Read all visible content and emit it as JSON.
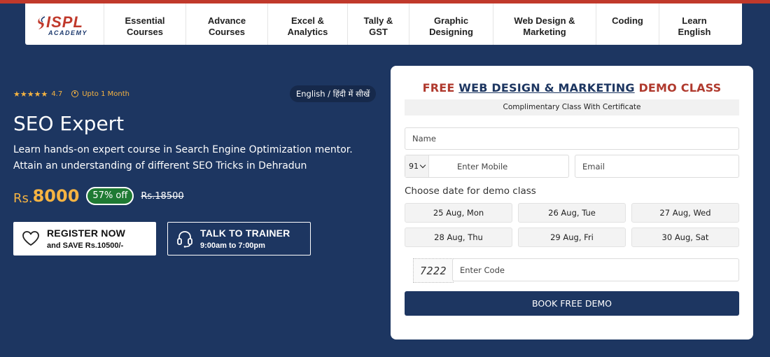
{
  "nav": {
    "logo": {
      "brand": "ISPL",
      "tagline": "ACADEMY"
    },
    "items": [
      {
        "label": "Essential\nCourses"
      },
      {
        "label": "Advance\nCourses"
      },
      {
        "label": "Excel &\nAnalytics"
      },
      {
        "label": "Tally &\nGST"
      },
      {
        "label": "Graphic\nDesigning"
      },
      {
        "label": "Web Design &\nMarketing"
      },
      {
        "label": "Coding"
      },
      {
        "label": "Learn\nEnglish"
      }
    ]
  },
  "hero": {
    "rating": {
      "stars": "★★★★★",
      "value": "4.7"
    },
    "duration": "Upto 1 Month",
    "language": "English / हिंदी में सीखें",
    "title": "SEO Expert",
    "description": "Learn hands-on expert course in Search Engine Optimization mentor. Attain an understanding of different SEO Tricks in Dehradun",
    "price": {
      "prefix": "Rs.",
      "value": "8000",
      "discount": "57% off",
      "original": "Rs.18500"
    },
    "register": {
      "title": "REGISTER NOW",
      "subtitle": "and SAVE Rs.10500/-"
    },
    "trainer": {
      "title": "TALK TO TRAINER",
      "subtitle": "9:00am to 7:00pm"
    }
  },
  "form": {
    "title_prefix": "FREE ",
    "title_highlight": "WEB DESIGN & MARKETING",
    "title_suffix": " DEMO CLASS",
    "certificate": "Complimentary Class With Certificate",
    "name_placeholder": "Name",
    "country_code": "91",
    "mobile_placeholder": "Enter Mobile",
    "email_placeholder": "Email",
    "choose_date_label": "Choose date for demo class",
    "dates": [
      "25 Aug, Mon",
      "26 Aug, Tue",
      "27 Aug, Wed",
      "28 Aug, Thu",
      "29 Aug, Fri",
      "30 Aug, Sat"
    ],
    "captcha": "7222",
    "code_placeholder": "Enter Code",
    "submit": "BOOK FREE DEMO"
  },
  "colors": {
    "background": "#1d3661",
    "accent": "#f5b342",
    "red": "#b03a2e",
    "badge": "#1f7a33"
  }
}
